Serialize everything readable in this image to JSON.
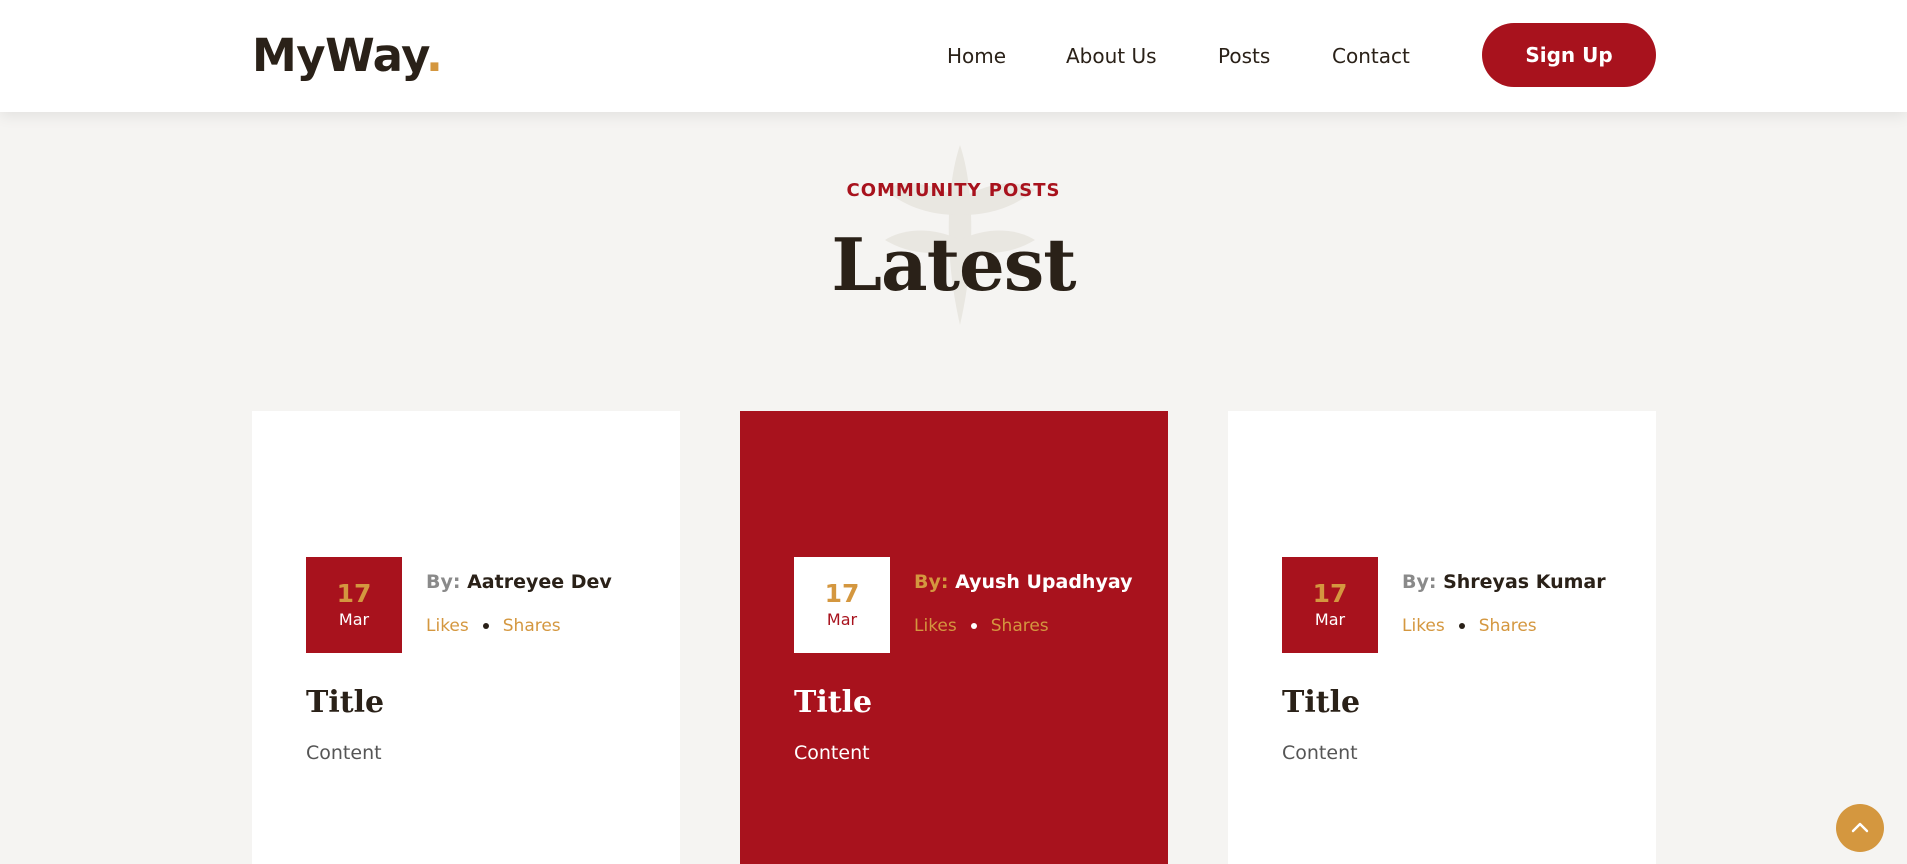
{
  "header": {
    "logo_text": "MyWay",
    "logo_dot": ".",
    "nav": [
      {
        "label": "Home"
      },
      {
        "label": "About Us"
      },
      {
        "label": "Posts"
      },
      {
        "label": "Contact"
      }
    ],
    "signup_label": "Sign Up"
  },
  "section": {
    "kicker": "COMMUNITY POSTS",
    "heading": "Latest"
  },
  "posts": [
    {
      "day": "17",
      "month": "Mar",
      "by_label": "By:",
      "author": "Aatreyee Dev",
      "likes": "Likes",
      "shares": "Shares",
      "title": "Title",
      "content": "Content"
    },
    {
      "day": "17",
      "month": "Mar",
      "by_label": "By:",
      "author": "Ayush Upadhyay",
      "likes": "Likes",
      "shares": "Shares",
      "title": "Title",
      "content": "Content"
    },
    {
      "day": "17",
      "month": "Mar",
      "by_label": "By:",
      "author": "Shreyas Kumar",
      "likes": "Likes",
      "shares": "Shares",
      "title": "Title",
      "content": "Content"
    }
  ],
  "icons": {
    "leaf": "leaf-watermark-icon",
    "scroll_top": "chevron-up-icon"
  },
  "colors": {
    "brand": "#a8121d",
    "accent": "#d4973f",
    "dark": "#2a2118",
    "background": "#f5f4f2"
  }
}
